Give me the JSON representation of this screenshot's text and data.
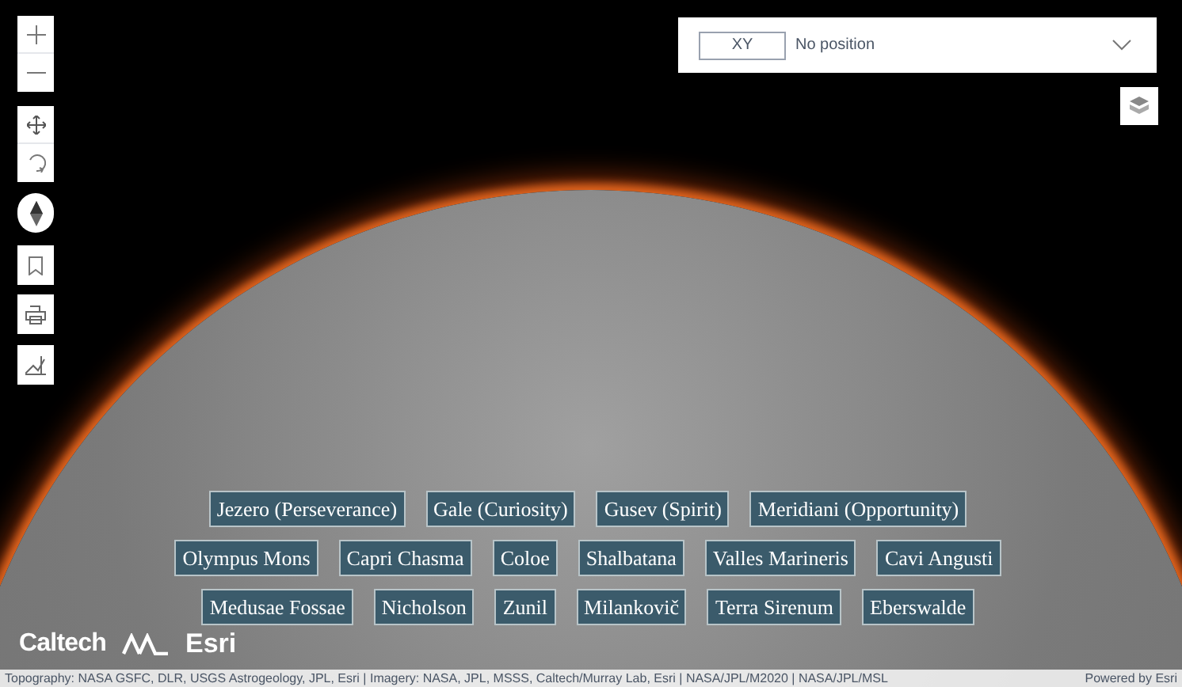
{
  "coordinate_widget": {
    "format": "XY",
    "position": "No position",
    "expanded": false
  },
  "place_labels": [
    [
      "Jezero (Perseverance)",
      "Gale (Curiosity)",
      "Gusev (Spirit)",
      "Meridiani (Opportunity)"
    ],
    [
      "Olympus Mons",
      "Capri Chasma",
      "Coloe",
      "Shalbatana",
      "Valles Marineris",
      "Cavi Angusti"
    ],
    [
      "Medusae Fossae",
      "Nicholson",
      "Zunil",
      "Milankovič",
      "Terra Sirenum",
      "Eberswalde"
    ]
  ],
  "logos": [
    "Caltech",
    "Esri"
  ],
  "attribution": "Topography: NASA GSFC, DLR, USGS Astrogeology, JPL, Esri | Imagery: NASA, JPL, MSSS, Caltech/Murray Lab, Esri | NASA/JPL/M2020 | NASA/JPL/MSL",
  "powered_by": "Powered by Esri"
}
